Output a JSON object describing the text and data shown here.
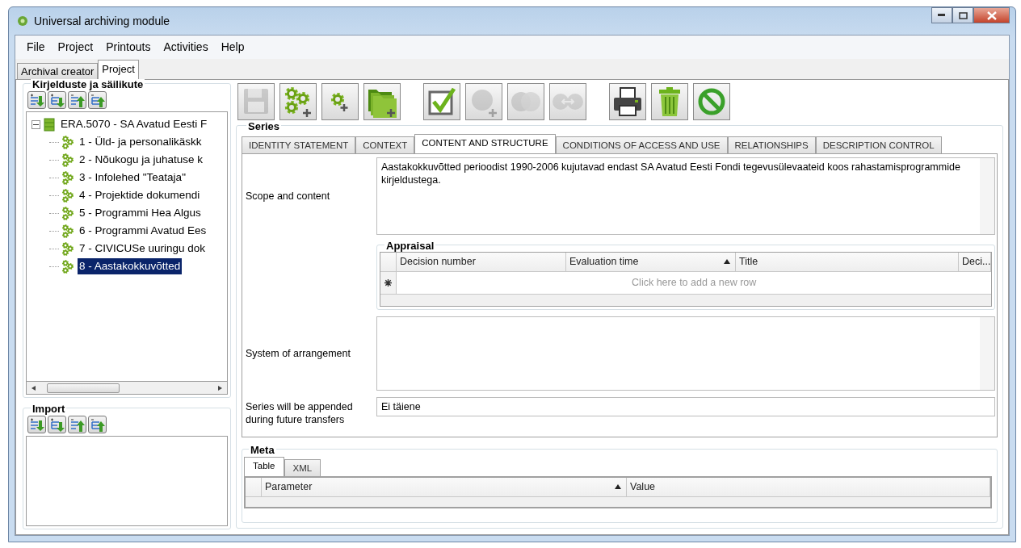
{
  "window": {
    "title": "Universal archiving module"
  },
  "menu": [
    "File",
    "Project",
    "Printouts",
    "Activities",
    "Help"
  ],
  "main_tabs": [
    {
      "label": "Archival creator",
      "selected": false
    },
    {
      "label": "Project",
      "selected": true
    }
  ],
  "descriptions_panel": {
    "title": "Kirjelduste ja säilikute",
    "buttons": [
      {
        "kind": "add-down"
      },
      {
        "kind": "insert-down"
      },
      {
        "kind": "add-up"
      },
      {
        "kind": "insert-up"
      }
    ],
    "tree": [
      {
        "label": "ERA.5070 - SA Avatud Eesti F",
        "kind": "fonds",
        "expanded": true,
        "selected": false,
        "children": [
          {
            "label": "1 - Üld- ja personalikäskk",
            "kind": "series",
            "selected": false
          },
          {
            "label": "2 - Nõukogu ja juhatuse k",
            "kind": "series",
            "selected": false
          },
          {
            "label": "3 - Infolehed \"Teataja\"",
            "kind": "series",
            "selected": false
          },
          {
            "label": "4 - Projektide dokumendi",
            "kind": "series",
            "selected": false
          },
          {
            "label": "5 - Programmi Hea Algus",
            "kind": "series",
            "selected": false
          },
          {
            "label": "6 - Programmi Avatud Ees",
            "kind": "series",
            "selected": false
          },
          {
            "label": "7 - CIVICUSe uuringu dok",
            "kind": "series",
            "selected": false
          },
          {
            "label": "8 - Aastakokkuvõtted",
            "kind": "series",
            "selected": true
          }
        ]
      }
    ]
  },
  "import_panel": {
    "title": "Import",
    "buttons": [
      {
        "kind": "add-down"
      },
      {
        "kind": "insert-down"
      },
      {
        "kind": "add-up"
      },
      {
        "kind": "insert-up"
      }
    ]
  },
  "toolbar": [
    [
      {
        "kind": "save",
        "disabled": true
      },
      {
        "kind": "gears-add",
        "disabled": false
      },
      {
        "kind": "gear-add",
        "disabled": false
      },
      {
        "kind": "folder-add",
        "disabled": false
      }
    ],
    [
      {
        "kind": "check",
        "disabled": false
      },
      {
        "kind": "circle-add",
        "disabled": true
      },
      {
        "kind": "circles",
        "disabled": true
      },
      {
        "kind": "circles-link",
        "disabled": true
      }
    ],
    [
      {
        "kind": "print",
        "disabled": false
      },
      {
        "kind": "delete",
        "disabled": false
      },
      {
        "kind": "cancel",
        "disabled": false
      }
    ]
  ],
  "series": {
    "title": "Series",
    "tabs": [
      {
        "label": "IDENTITY STATEMENT",
        "selected": false
      },
      {
        "label": "CONTEXT",
        "selected": false
      },
      {
        "label": "CONTENT AND STRUCTURE",
        "selected": true
      },
      {
        "label": "CONDITIONS OF ACCESS AND USE",
        "selected": false
      },
      {
        "label": "RELATIONSHIPS",
        "selected": false
      },
      {
        "label": "DESCRIPTION CONTROL",
        "selected": false
      }
    ],
    "scope_and_content": {
      "label": "Scope and content",
      "value": "Aastakokkuvõtted perioodist 1990-2006 kujutavad endast SA Avatud Eesti Fondi tegevusülevaateid koos rahastamisprogrammide kirjeldustega."
    },
    "appraisal": {
      "title": "Appraisal",
      "columns": [
        {
          "label": "Decision number",
          "sorted": false
        },
        {
          "label": "Evaluation time",
          "sorted": true
        },
        {
          "label": "Title",
          "sorted": false
        },
        {
          "label": "Deci...",
          "sorted": false
        }
      ],
      "new_row": "Click here to add a new row"
    },
    "system_of_arrangement": {
      "label": "System of arrangement"
    },
    "appended": {
      "label": "Series will be appended during future transfers",
      "value": "Ei täiene"
    },
    "meta": {
      "title": "Meta",
      "tabs": [
        {
          "label": "Table",
          "selected": true
        },
        {
          "label": "XML",
          "selected": false
        }
      ],
      "columns": [
        {
          "label": "Parameter",
          "sorted": true
        },
        {
          "label": "Value",
          "sorted": false
        }
      ]
    }
  }
}
